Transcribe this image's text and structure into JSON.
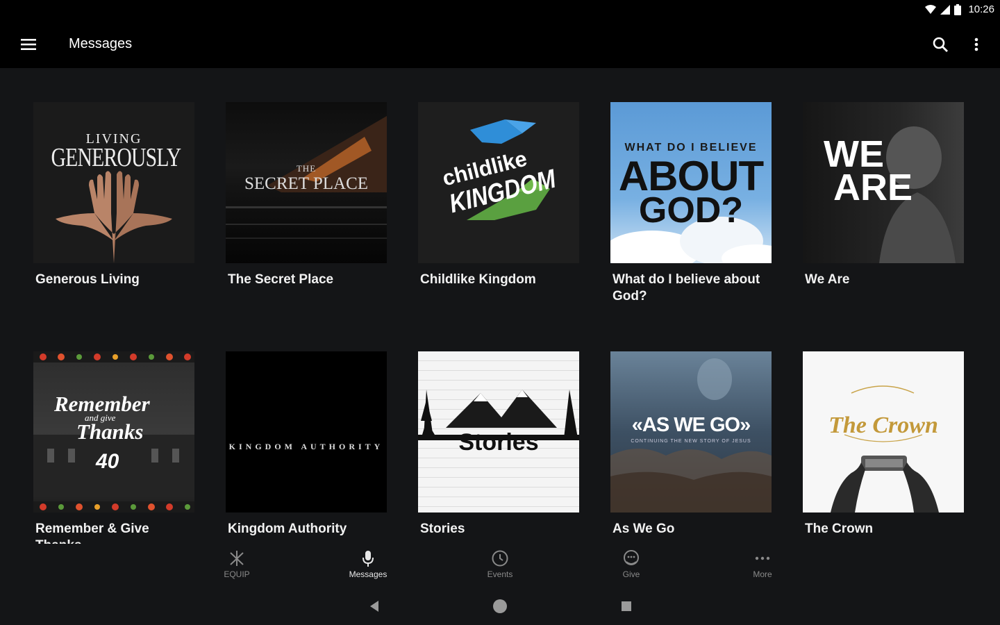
{
  "status_bar": {
    "time": "10:26"
  },
  "app_bar": {
    "title": "Messages"
  },
  "cards": [
    {
      "title": "Generous Living",
      "art": {
        "line1": "LIVING",
        "line2": "GENEROUSLY"
      }
    },
    {
      "title": "The Secret Place",
      "art": {
        "line1": "THE",
        "line2": "SECRET PLACE"
      }
    },
    {
      "title": "Childlike Kingdom",
      "art": {
        "line1": "childlike",
        "line2": "KINGDOM"
      }
    },
    {
      "title": "What do I believe about God?",
      "art": {
        "line1": "WHAT DO I BELIEVE",
        "line2": "ABOUT",
        "line3": "GOD?"
      }
    },
    {
      "title": "We Are",
      "art": {
        "line1": "WE",
        "line2": "ARE"
      }
    },
    {
      "title": "Remember & Give Thanks",
      "art": {
        "line1": "Remember",
        "line2": "and give",
        "line3": "Thanks",
        "line4": "40"
      }
    },
    {
      "title": "Kingdom Authority",
      "art": {
        "line1": "KINGDOM AUTHORITY"
      }
    },
    {
      "title": "Stories",
      "art": {
        "line1": "Stories"
      }
    },
    {
      "title": "As We Go",
      "art": {
        "line1": "«AS WE GO»",
        "line2": "CONTINUING THE NEW STORY OF JESUS"
      }
    },
    {
      "title": "The Crown",
      "art": {
        "line1": "The Crown"
      }
    }
  ],
  "bottom_nav": [
    {
      "label": "EQUIP",
      "icon": "equip-icon"
    },
    {
      "label": "Messages",
      "icon": "microphone-icon",
      "active": true
    },
    {
      "label": "Events",
      "icon": "clock-icon"
    },
    {
      "label": "Give",
      "icon": "give-icon"
    },
    {
      "label": "More",
      "icon": "more-horizontal-icon"
    }
  ],
  "colors": {
    "background": "#141517",
    "app_bar": "#000000",
    "nav_inactive": "#8a8a8a"
  }
}
